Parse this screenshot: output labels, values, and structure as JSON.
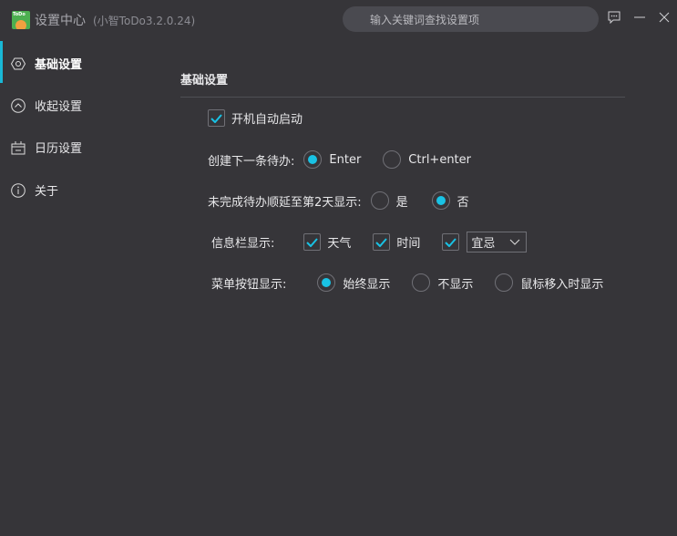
{
  "window": {
    "title": "设置中心",
    "version": "(小智ToDo3.2.0.24)",
    "logo_text": "ToDo",
    "search_placeholder": "输入关键词查找设置项"
  },
  "sidebar": {
    "items": [
      {
        "label": "基础设置",
        "icon": "gear-icon",
        "active": true
      },
      {
        "label": "收起设置",
        "icon": "chevron-up-circle-icon"
      },
      {
        "label": "日历设置",
        "icon": "calendar-icon"
      },
      {
        "label": "关于",
        "icon": "info-icon"
      }
    ]
  },
  "main": {
    "section_title": "基础设置",
    "autostart": {
      "label": "开机自动启动",
      "checked": true
    },
    "create_next": {
      "label": "创建下一条待办:",
      "options": [
        "Enter",
        "Ctrl+enter"
      ],
      "selected": "Enter"
    },
    "postpone": {
      "label": "未完成待办顺延至第2天显示:",
      "options": [
        "是",
        "否"
      ],
      "selected": "否"
    },
    "infobar": {
      "label": "信息栏显示:",
      "weather": "天气",
      "time": "时间",
      "almanac_select": "宜忌"
    },
    "menu_buttons": {
      "label": "菜单按钮显示:",
      "options": [
        "始终显示",
        "不显示",
        "鼠标移入时显示"
      ],
      "selected": "始终显示"
    }
  },
  "colors": {
    "accent": "#19c2e4",
    "background": "#363539"
  }
}
